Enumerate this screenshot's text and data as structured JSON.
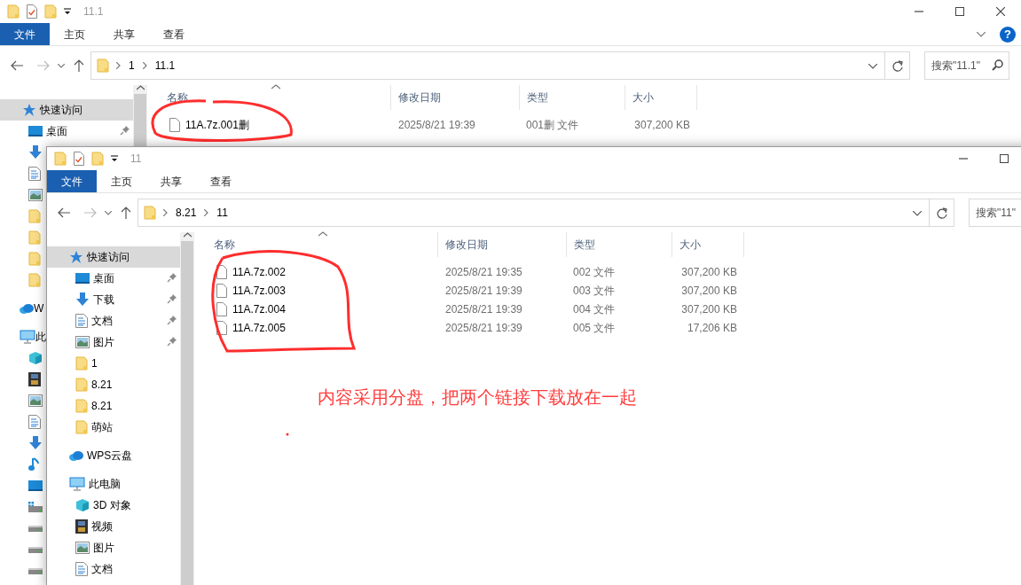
{
  "windows": [
    {
      "title": "11.1",
      "ribbon_tabs": [
        {
          "label": "文件",
          "selected": true
        },
        {
          "label": "主页",
          "selected": false
        },
        {
          "label": "共享",
          "selected": false
        },
        {
          "label": "查看",
          "selected": false
        }
      ],
      "caption_buttons": [
        {
          "kind": "minimize"
        },
        {
          "kind": "maximize"
        },
        {
          "kind": "close"
        }
      ],
      "help": {
        "label": "?"
      },
      "breadcrumb": [
        "1",
        "11.1"
      ],
      "search": {
        "placeholder": "搜索\"11.1\""
      },
      "sidebar": [
        {
          "label": "快速访问",
          "kind": "star",
          "selected": true,
          "children": [
            {
              "label": "桌面",
              "kind": "desktop",
              "selected": false,
              "pinned": true
            },
            {
              "kind": "download",
              "selected": false,
              "pinned": false
            },
            {
              "kind": "document",
              "selected": false,
              "pinned": false
            },
            {
              "kind": "pictures",
              "selected": false,
              "pinned": false
            },
            {
              "kind": "folder",
              "selected": false,
              "pinned": false
            },
            {
              "kind": "folder",
              "selected": false,
              "pinned": false
            },
            {
              "kind": "folder",
              "selected": false,
              "pinned": false
            },
            {
              "kind": "folder",
              "selected": false,
              "pinned": false
            }
          ]
        },
        {
          "label": "W",
          "kind": "cloud",
          "selected": false
        },
        {
          "label": "此",
          "kind": "pc",
          "selected": false,
          "children": [
            {
              "kind": "cube",
              "selected": false,
              "pinned": false
            },
            {
              "kind": "video",
              "selected": false,
              "pinned": false
            },
            {
              "kind": "pictures",
              "selected": false,
              "pinned": false
            },
            {
              "kind": "document",
              "selected": false,
              "pinned": false
            },
            {
              "kind": "download",
              "selected": false,
              "pinned": false
            },
            {
              "kind": "music",
              "selected": false,
              "pinned": false
            },
            {
              "kind": "desktop",
              "selected": false,
              "pinned": false
            },
            {
              "kind": "system-drive",
              "selected": false,
              "pinned": false
            },
            {
              "kind": "drive",
              "selected": false,
              "pinned": false
            },
            {
              "kind": "drive",
              "selected": false,
              "pinned": false
            },
            {
              "kind": "drive",
              "selected": false,
              "pinned": false
            }
          ]
        }
      ],
      "columns": [
        "名称",
        "修改日期",
        "类型",
        "大小"
      ],
      "rows": [
        {
          "name": "11A.7z.001删",
          "modified": "2025/8/21 19:39",
          "type": "001删 文件",
          "size": "307,200 KB"
        }
      ]
    },
    {
      "title": "11",
      "ribbon_tabs": [
        {
          "label": "文件",
          "selected": true
        },
        {
          "label": "主页",
          "selected": false
        },
        {
          "label": "共享",
          "selected": false
        },
        {
          "label": "查看",
          "selected": false
        }
      ],
      "caption_buttons": [
        {
          "kind": "minimize"
        },
        {
          "kind": "maximize"
        }
      ],
      "breadcrumb": [
        "8.21",
        "11"
      ],
      "search": {
        "placeholder": "搜索\"11\""
      },
      "sidebar": [
        {
          "label": "快速访问",
          "kind": "star",
          "selected": true,
          "children": [
            {
              "label": "桌面",
              "kind": "desktop",
              "selected": false,
              "pinned": true
            },
            {
              "label": "下载",
              "kind": "download",
              "selected": false,
              "pinned": true
            },
            {
              "label": "文档",
              "kind": "document",
              "selected": false,
              "pinned": true
            },
            {
              "label": "图片",
              "kind": "pictures",
              "selected": false,
              "pinned": true
            },
            {
              "label": "1",
              "kind": "folder",
              "selected": false,
              "pinned": false
            },
            {
              "label": "8.21",
              "kind": "folder",
              "selected": false,
              "pinned": false
            },
            {
              "label": "8.21",
              "kind": "folder",
              "selected": false,
              "pinned": false
            },
            {
              "label": "萌站",
              "kind": "folder",
              "selected": false,
              "pinned": false
            }
          ]
        },
        {
          "label": "WPS云盘",
          "kind": "cloud",
          "selected": false
        },
        {
          "label": "此电脑",
          "kind": "pc",
          "selected": false,
          "children": [
            {
              "label": "3D 对象",
              "kind": "cube",
              "selected": false,
              "pinned": false
            },
            {
              "label": "视频",
              "kind": "video",
              "selected": false,
              "pinned": false
            },
            {
              "label": "图片",
              "kind": "pictures",
              "selected": false,
              "pinned": false
            },
            {
              "label": "文档",
              "kind": "document",
              "selected": false,
              "pinned": false
            }
          ]
        }
      ],
      "columns": [
        "名称",
        "修改日期",
        "类型",
        "大小"
      ],
      "rows": [
        {
          "name": "11A.7z.002",
          "modified": "2025/8/21 19:35",
          "type": "002 文件",
          "size": "307,200 KB"
        },
        {
          "name": "11A.7z.003",
          "modified": "2025/8/21 19:39",
          "type": "003 文件",
          "size": "307,200 KB"
        },
        {
          "name": "11A.7z.004",
          "modified": "2025/8/21 19:39",
          "type": "004 文件",
          "size": "307,200 KB"
        },
        {
          "name": "11A.7z.005",
          "modified": "2025/8/21 19:39",
          "type": "005 文件",
          "size": "17,206 KB"
        }
      ]
    }
  ],
  "annotation": {
    "text": "内容采用分盘，把两个链接下载放在一起"
  }
}
